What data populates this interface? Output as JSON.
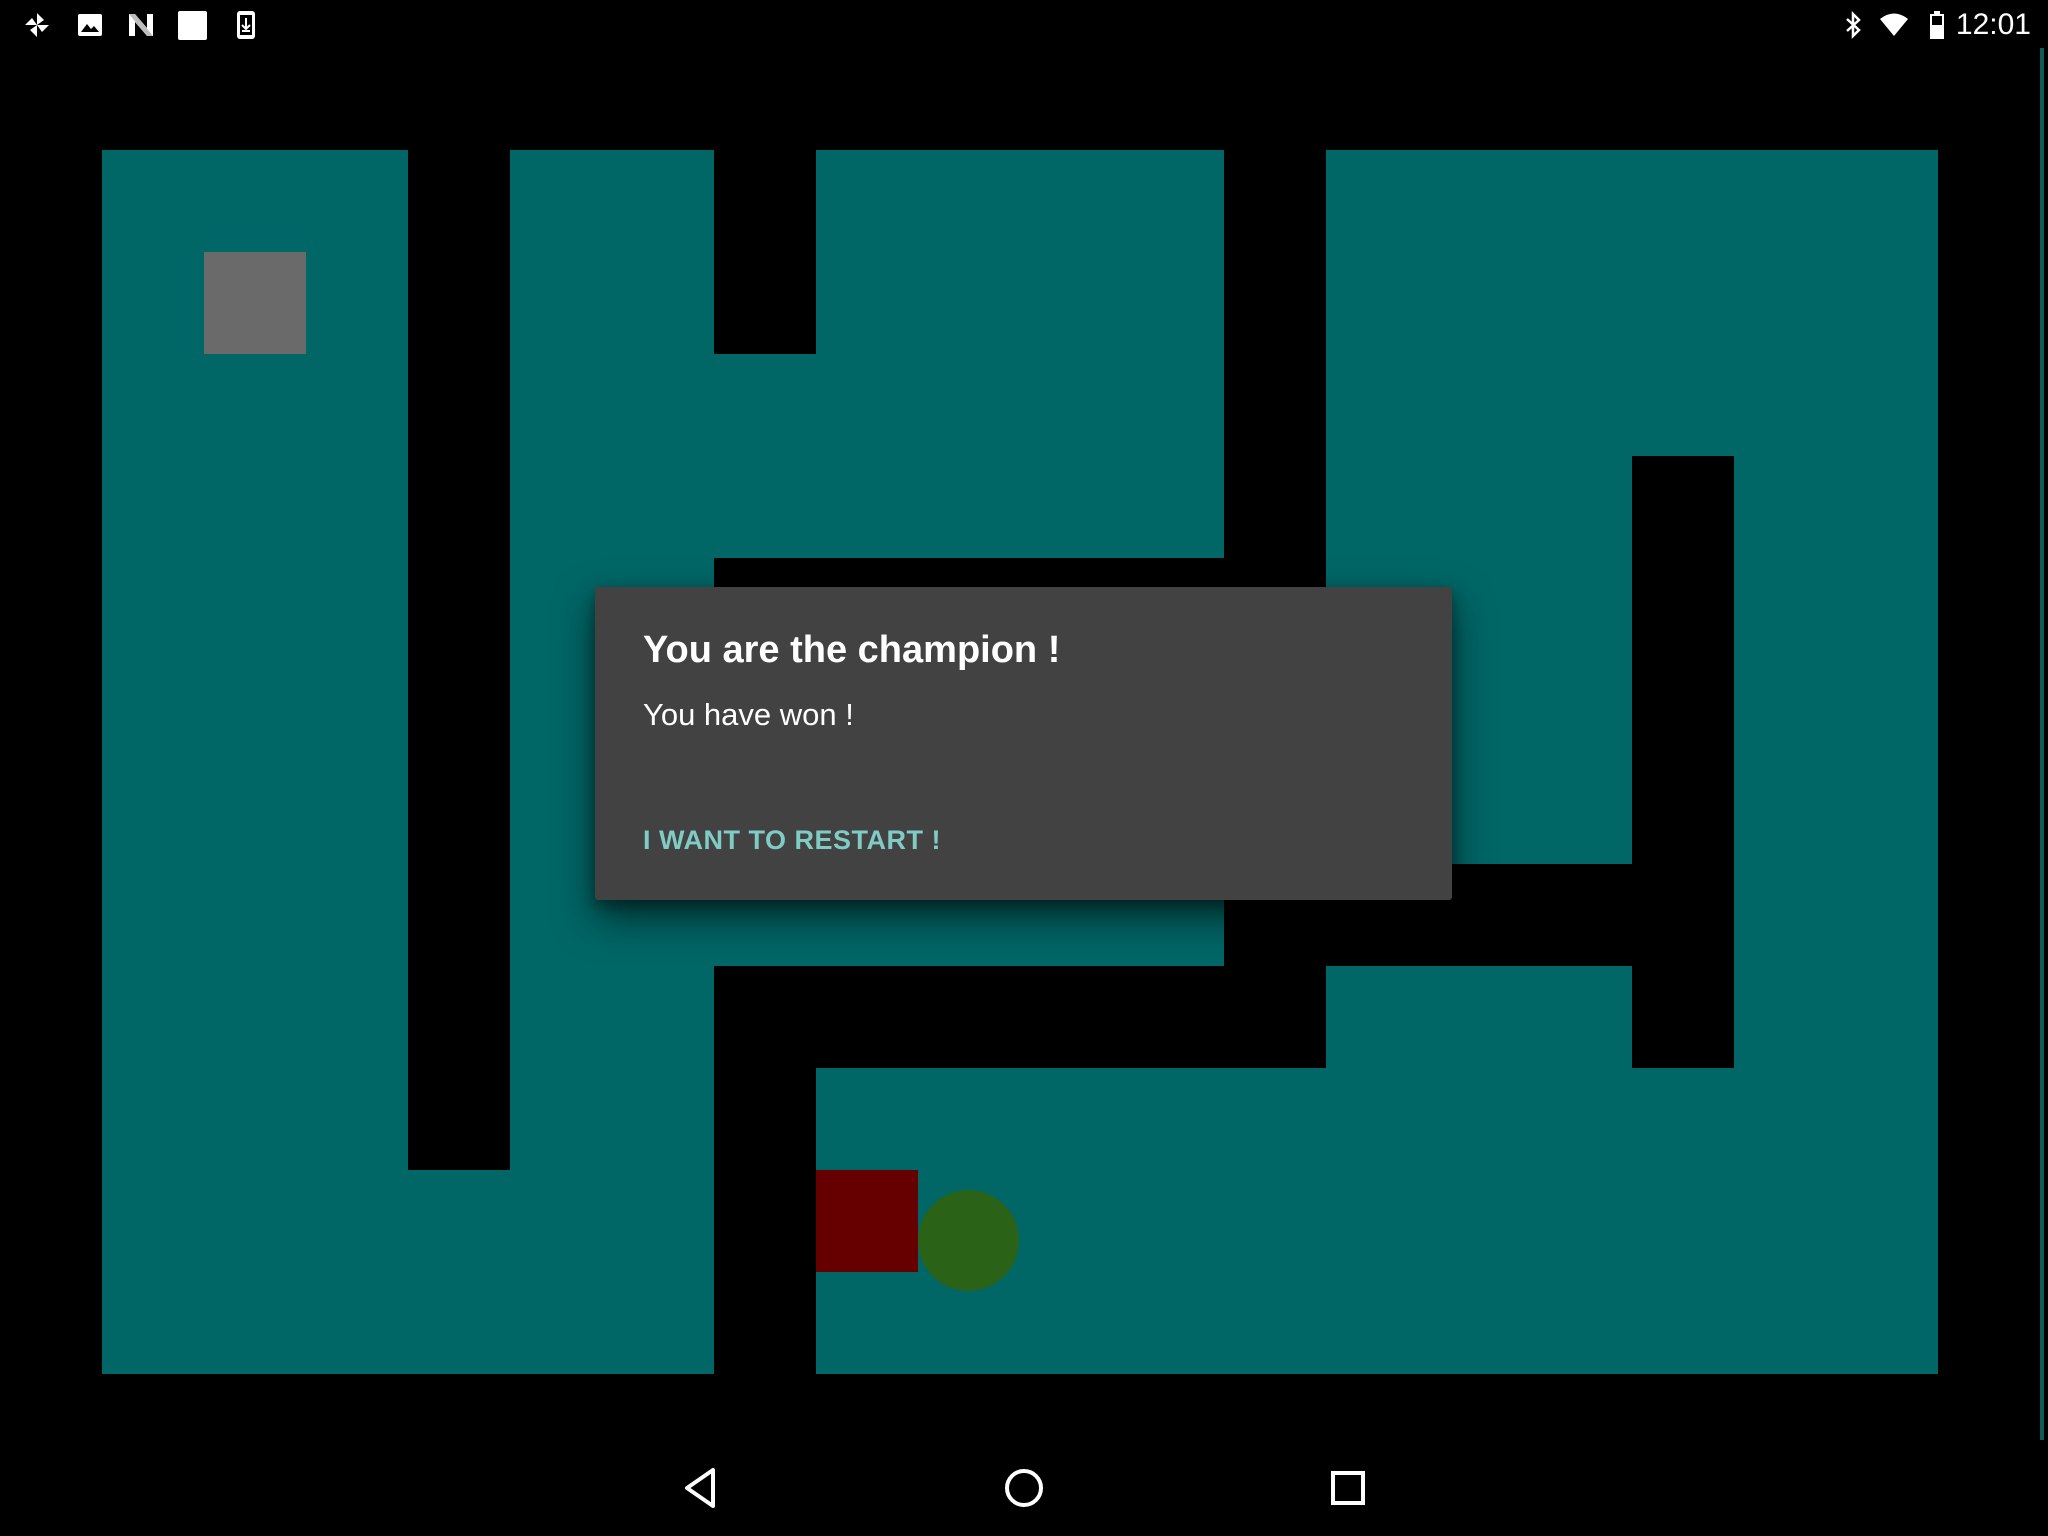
{
  "status_bar": {
    "time": "12:01",
    "left_icons": [
      "pinwheel-icon",
      "image-icon",
      "n-logo-icon",
      "square-icon",
      "download-icon"
    ],
    "right_icons": [
      "bluetooth-icon",
      "wifi-icon",
      "battery-icon"
    ]
  },
  "game": {
    "colors": {
      "background": "#000000",
      "floor": "#006666",
      "exit_tile": "#6a6a6a",
      "enemy_block": "#660000",
      "player_ball": "#2a6318"
    }
  },
  "dialog": {
    "title": "You are the champion !",
    "message": "You have won !",
    "button_label": "I WANT TO RESTART !",
    "background_color": "#424242",
    "button_color": "#80cbc4"
  },
  "nav_bar": {
    "buttons": [
      "back-icon",
      "home-icon",
      "recents-icon"
    ]
  }
}
